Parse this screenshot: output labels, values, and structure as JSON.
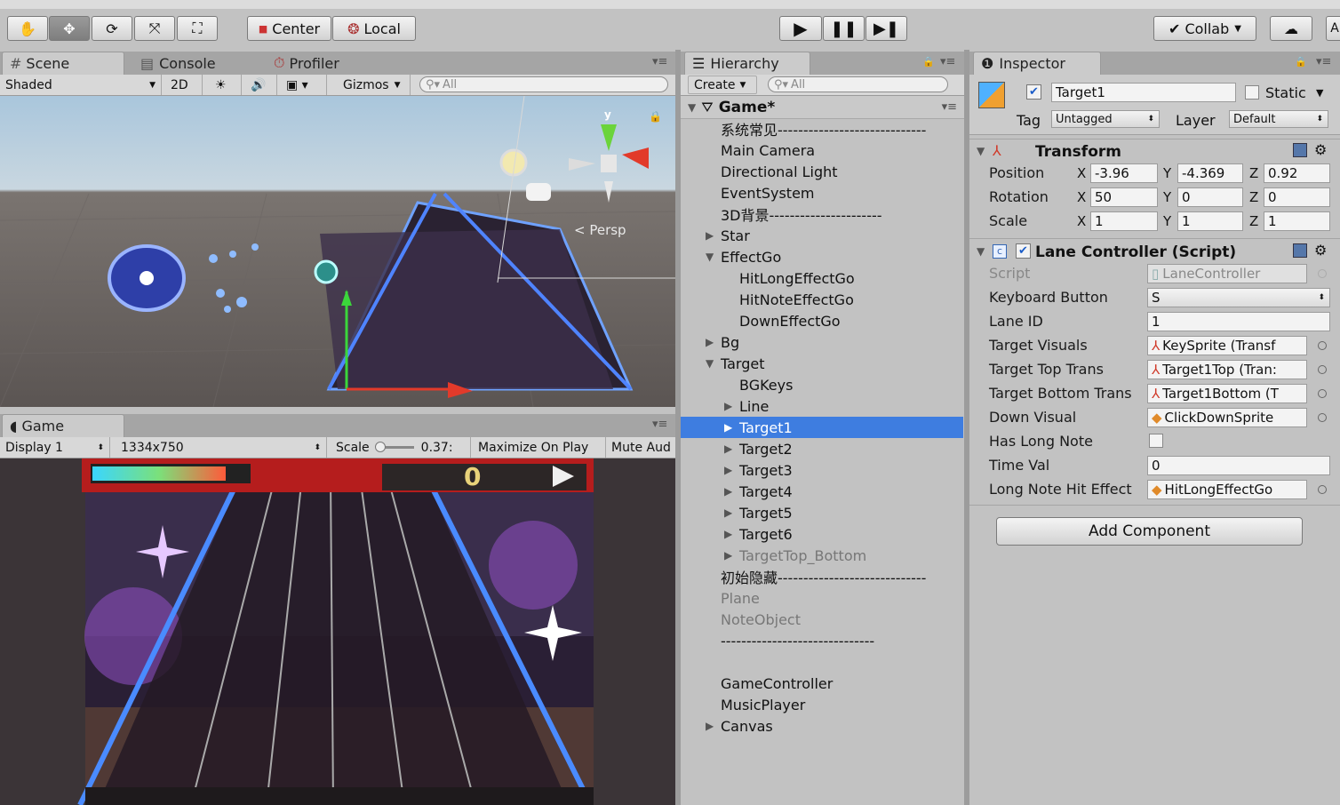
{
  "toolbar": {
    "transform_tools": [
      "hand-tool-icon",
      "move-tool-icon",
      "rotate-tool-icon",
      "scale-tool-icon",
      "rect-tool-icon"
    ],
    "pivot_label": "Center",
    "space_label": "Local",
    "collab_label": "Collab"
  },
  "scene": {
    "tabs": [
      "Scene",
      "Console",
      "Profiler"
    ],
    "shading": "Shaded",
    "mode_2d": "2D",
    "gizmos": "Gizmos",
    "search_placeholder": "All",
    "persp_label": "< Persp",
    "gizmo_axis": "y"
  },
  "game": {
    "tab": "Game",
    "display": "Display 1",
    "resolution": "1334x750",
    "scale_label": "Scale",
    "scale_value": "0.37:",
    "maximize": "Maximize On Play",
    "mute": "Mute Aud",
    "score": "0"
  },
  "hierarchy": {
    "tab": "Hierarchy",
    "create": "Create",
    "search_placeholder": "All",
    "scene_name": "Game*",
    "rows": [
      {
        "text": "系统常见-----------------------------",
        "indent": 0,
        "arrow": "",
        "style": "normal"
      },
      {
        "text": "Main Camera",
        "indent": 0,
        "arrow": "",
        "style": "normal"
      },
      {
        "text": "Directional Light",
        "indent": 0,
        "arrow": "",
        "style": "normal"
      },
      {
        "text": "EventSystem",
        "indent": 0,
        "arrow": "",
        "style": "normal"
      },
      {
        "text": "3D背景----------------------",
        "indent": 0,
        "arrow": "",
        "style": "normal"
      },
      {
        "text": "Star",
        "indent": 0,
        "arrow": "▶",
        "style": "normal"
      },
      {
        "text": "EffectGo",
        "indent": 0,
        "arrow": "▼",
        "style": "normal"
      },
      {
        "text": "HitLongEffectGo",
        "indent": 1,
        "arrow": "",
        "style": "normal"
      },
      {
        "text": "HitNoteEffectGo",
        "indent": 1,
        "arrow": "",
        "style": "normal"
      },
      {
        "text": "DownEffectGo",
        "indent": 1,
        "arrow": "",
        "style": "normal"
      },
      {
        "text": "Bg",
        "indent": 0,
        "arrow": "▶",
        "style": "normal"
      },
      {
        "text": "Target",
        "indent": 0,
        "arrow": "▼",
        "style": "normal"
      },
      {
        "text": "BGKeys",
        "indent": 1,
        "arrow": "",
        "style": "normal"
      },
      {
        "text": "Line",
        "indent": 1,
        "arrow": "▶",
        "style": "normal"
      },
      {
        "text": "Target1",
        "indent": 1,
        "arrow": "▶",
        "style": "selected"
      },
      {
        "text": "Target2",
        "indent": 1,
        "arrow": "▶",
        "style": "normal"
      },
      {
        "text": "Target3",
        "indent": 1,
        "arrow": "▶",
        "style": "normal"
      },
      {
        "text": "Target4",
        "indent": 1,
        "arrow": "▶",
        "style": "normal"
      },
      {
        "text": "Target5",
        "indent": 1,
        "arrow": "▶",
        "style": "normal"
      },
      {
        "text": "Target6",
        "indent": 1,
        "arrow": "▶",
        "style": "normal"
      },
      {
        "text": "TargetTop_Bottom",
        "indent": 1,
        "arrow": "▶",
        "style": "dim"
      },
      {
        "text": "初始隐藏-----------------------------",
        "indent": 0,
        "arrow": "",
        "style": "normal"
      },
      {
        "text": "Plane",
        "indent": 0,
        "arrow": "",
        "style": "dim"
      },
      {
        "text": "NoteObject",
        "indent": 0,
        "arrow": "",
        "style": "dim"
      },
      {
        "text": "------------------------------",
        "indent": 0,
        "arrow": "",
        "style": "normal"
      },
      {
        "text": "",
        "indent": 0,
        "arrow": "",
        "style": "normal"
      },
      {
        "text": "GameController",
        "indent": 0,
        "arrow": "",
        "style": "normal"
      },
      {
        "text": "MusicPlayer",
        "indent": 0,
        "arrow": "",
        "style": "normal"
      },
      {
        "text": "Canvas",
        "indent": 0,
        "arrow": "▶",
        "style": "normal"
      }
    ]
  },
  "inspector": {
    "tab": "Inspector",
    "object_name": "Target1",
    "static_label": "Static",
    "tag_label": "Tag",
    "tag_value": "Untagged",
    "layer_label": "Layer",
    "layer_value": "Default",
    "transform": {
      "title": "Transform",
      "position": {
        "label": "Position",
        "x": "-3.96",
        "y": "-4.369",
        "z": "0.92"
      },
      "rotation": {
        "label": "Rotation",
        "x": "50",
        "y": "0",
        "z": "0"
      },
      "scale": {
        "label": "Scale",
        "x": "1",
        "y": "1",
        "z": "1"
      }
    },
    "script": {
      "title": "Lane Controller (Script)",
      "script_label": "Script",
      "script_value": "LaneController",
      "keyboard_label": "Keyboard Button",
      "keyboard_value": "S",
      "lane_label": "Lane ID",
      "lane_value": "1",
      "tv_label": "Target Visuals",
      "tv_value": "KeySprite (Transf",
      "ttt_label": "Target Top Trans",
      "ttt_value": "Target1Top (Tran:",
      "tbt_label": "Target Bottom Trans",
      "tbt_value": "Target1Bottom (T",
      "dv_label": "Down Visual",
      "dv_value": "ClickDownSprite",
      "hln_label": "Has Long Note",
      "tv2_label": "Time Val",
      "tv2_value": "0",
      "lnhe_label": "Long Note Hit Effect",
      "lnhe_value": "HitLongEffectGo"
    },
    "add_component": "Add Component"
  }
}
